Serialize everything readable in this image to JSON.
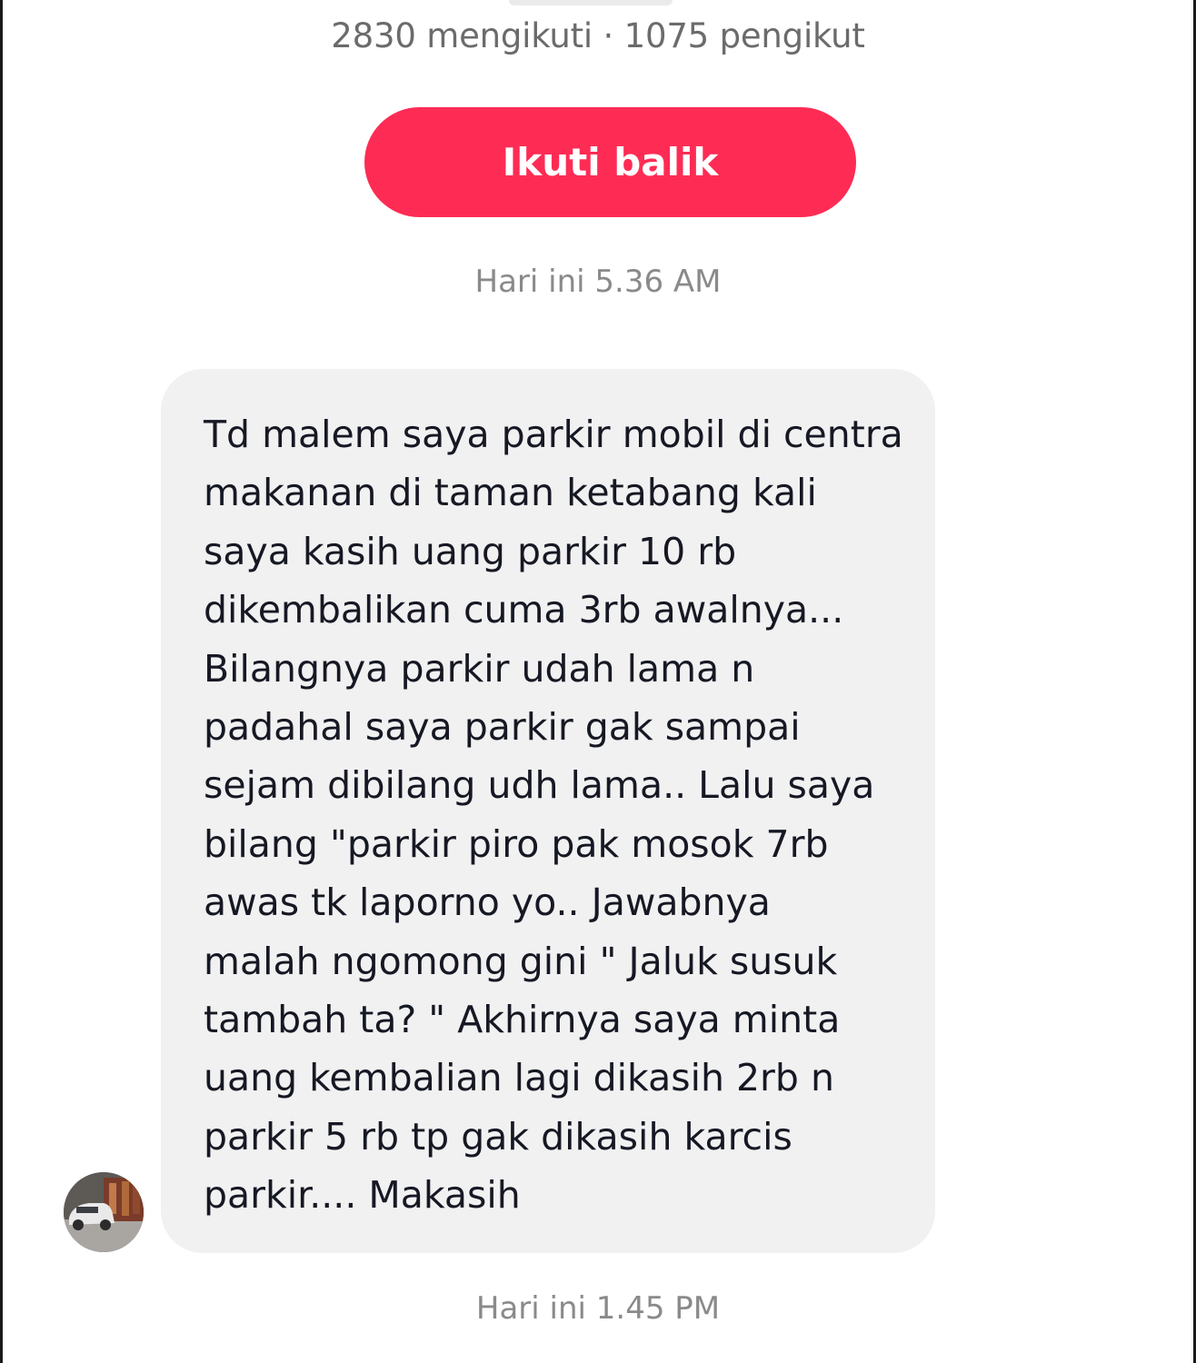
{
  "profile": {
    "stats": "2830 mengikuti · 1075 pengikut",
    "follow_back_label": "Ikuti balik"
  },
  "conversation": {
    "timestamp_1": "Hari ini 5.36 AM",
    "message": {
      "lines": [
        "Td malem saya parkir mobil di centra",
        "makanan di taman ketabang kali",
        "saya kasih uang parkir 10 rb",
        "dikembalikan cuma 3rb awalnya...",
        "Bilangnya parkir udah lama n",
        "padahal saya parkir gak sampai",
        "sejam dibilang udh lama.. Lalu saya",
        "bilang \"parkir piro pak mosok 7rb",
        "awas tk laporno yo.. Jawabnya",
        "malah ngomong gini \" Jaluk susuk",
        "tambah ta? \" Akhirnya saya minta",
        "uang kembalian lagi dikasih 2rb n",
        "parkir 5 rb tp gak dikasih karcis",
        "parkir.... Makasih"
      ]
    },
    "timestamp_2": "Hari ini 1.45 PM"
  },
  "colors": {
    "accent": "#fe2c55",
    "bubble": "#f1f1f2",
    "text": "#161823",
    "muted": "#8a8a8a"
  }
}
